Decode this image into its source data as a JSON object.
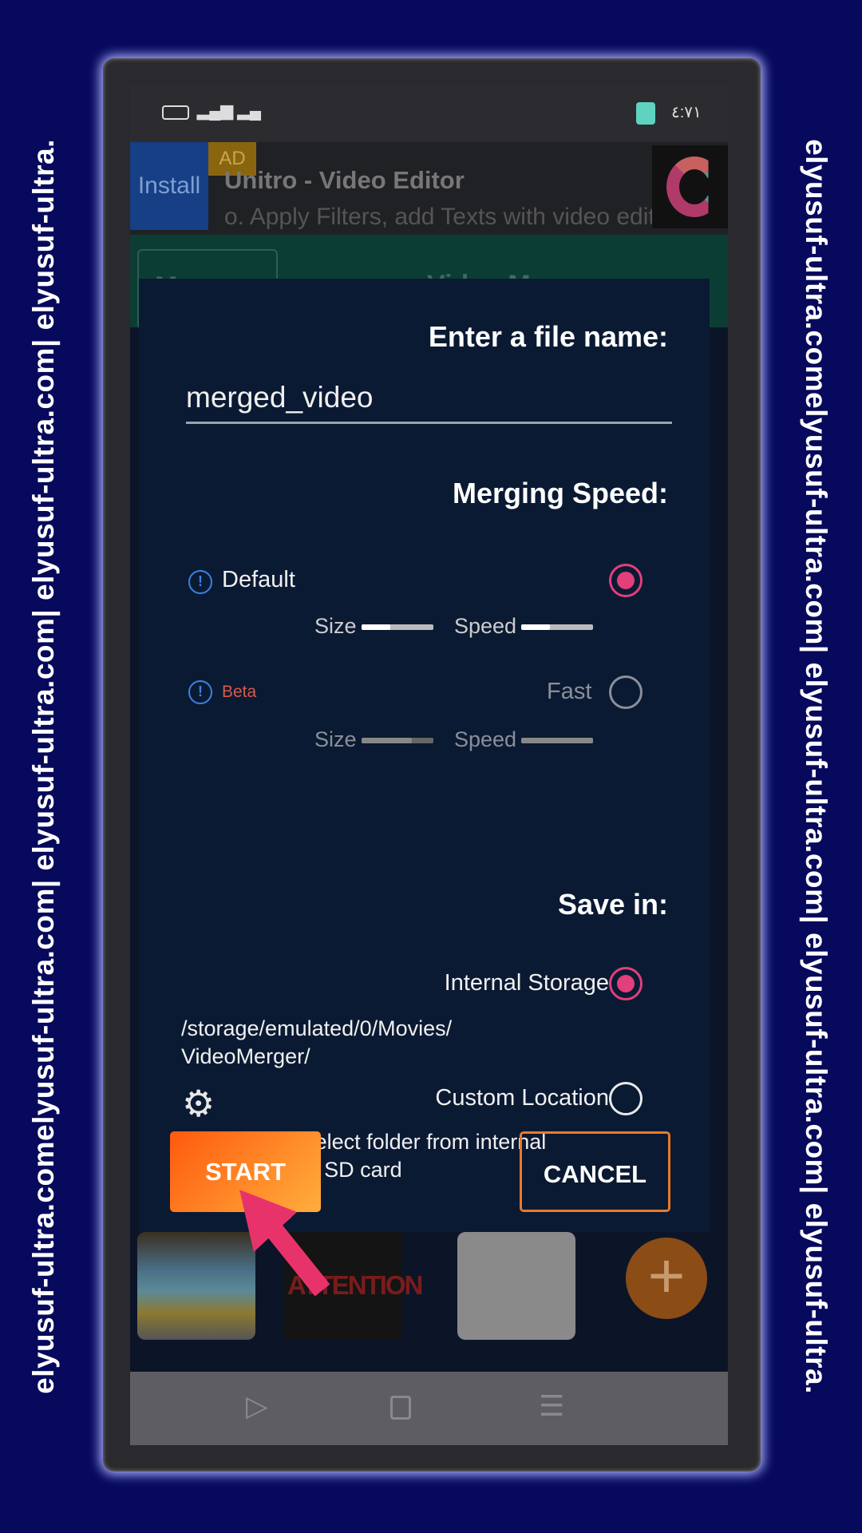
{
  "watermark": "elyusuf-ultra.comelyusuf-ultra.com| elyusuf-ultra.com| elyusuf-ultra.com| elyusuf-ultra.",
  "status": {
    "time": "٤:٧١"
  },
  "ad": {
    "install": "Install",
    "badge": "AD",
    "title": "Unitro - Video Editor",
    "subtitle": "o. Apply Filters, add Texts with video edit"
  },
  "toolbar": {
    "button": "Merge",
    "title": "Video Merger"
  },
  "dialog": {
    "file_label": "Enter a file name:",
    "file_value": "merged_video",
    "speed_label": "Merging Speed:",
    "default_label": "Default",
    "beta_label": "Beta",
    "fast_label": "Fast",
    "size_label": "Size",
    "speed_small": "Speed",
    "default_size": 0.4,
    "default_speed": 0.4,
    "fast_size": 0.7,
    "fast_speed": 1.0,
    "save_label": "Save in:",
    "internal_label": "Internal Storage",
    "path_line1": "/storage/emulated/0/Movies/",
    "path_line2": "VideoMerger/",
    "custom_label": "Custom Location",
    "hint_line1": "You can select folder from internal",
    "hint_line2": "storage or SD card",
    "start": "START",
    "cancel": "CANCEL",
    "selected_speed": "Default",
    "selected_location": "Internal Storage"
  },
  "thumbnail_text": "ATTENTION",
  "colors": {
    "accent": "#e23f7b",
    "start": "#ff7a20",
    "background": "#07095c",
    "arrow": "#e8336a"
  }
}
